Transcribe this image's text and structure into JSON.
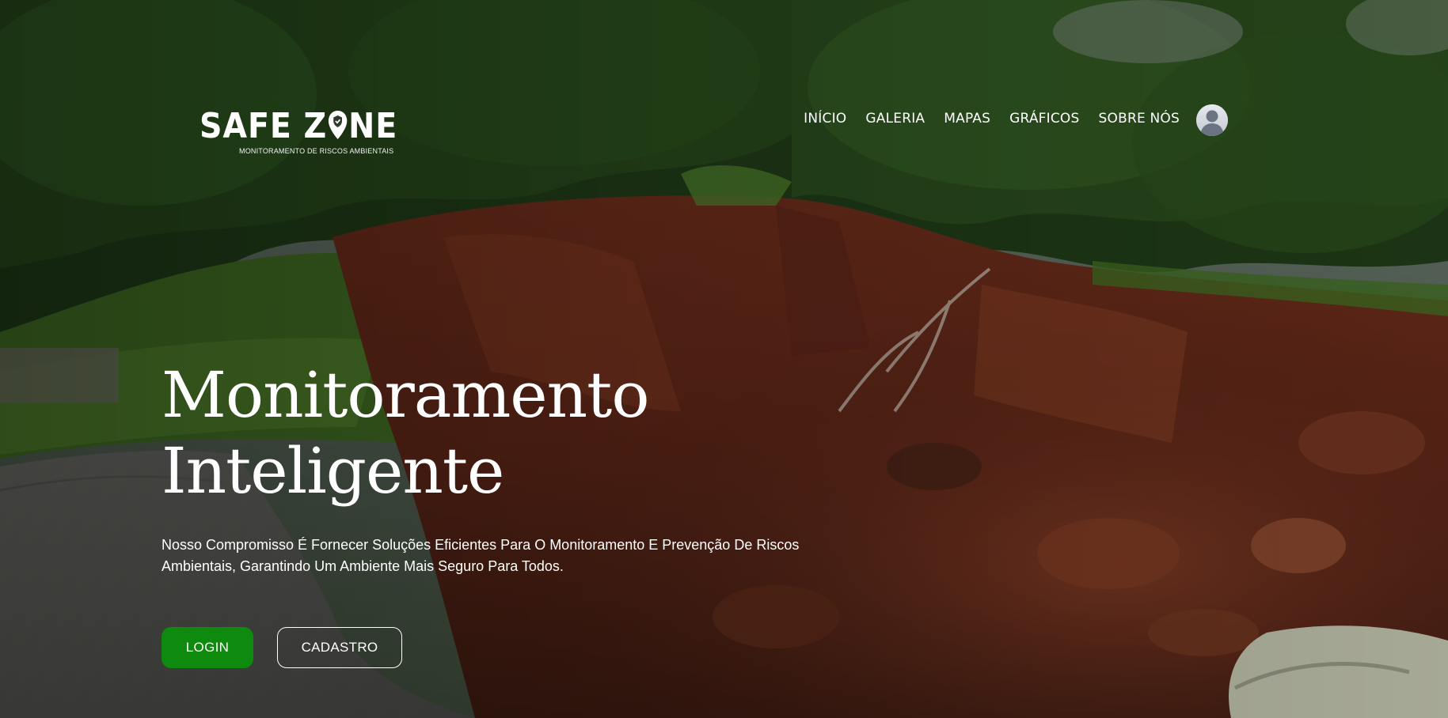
{
  "brand": {
    "name_part1": "SAFE Z",
    "name_part2": "NE",
    "tagline": "MONITORAMENTO DE RISCOS AMBIENTAIS",
    "icon": "location-pin-shield-icon"
  },
  "nav": {
    "items": [
      {
        "label": "INÍCIO"
      },
      {
        "label": "GALERIA"
      },
      {
        "label": "MAPAS"
      },
      {
        "label": "GRÁFICOS"
      },
      {
        "label": "SOBRE NÓS"
      }
    ],
    "avatar_icon": "user-avatar-icon"
  },
  "hero": {
    "headline_line1": "Monitoramento",
    "headline_line2": "Inteligente",
    "subtitle": "Nosso Compromisso É Fornecer Soluções Eficientes Para O Monitoramento E Prevenção De Riscos Ambientais, Garantindo Um Ambiente Mais Seguro Para Todos.",
    "login_label": "LOGIN",
    "cadastro_label": "CADASTRO"
  },
  "colors": {
    "primary_button": "#0e8a0e",
    "text": "#ffffff"
  }
}
